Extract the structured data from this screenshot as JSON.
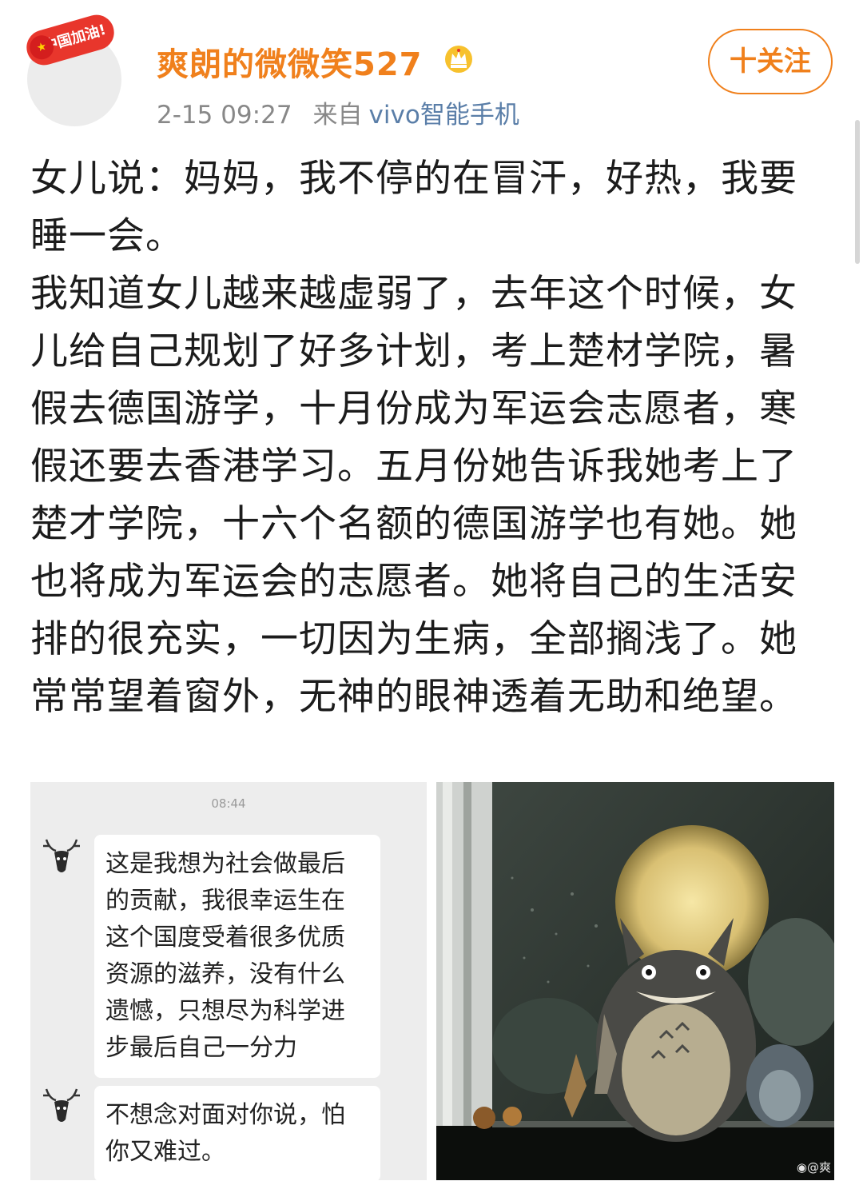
{
  "header": {
    "badge_text": "中国加油!",
    "username": "爽朗的微微笑527",
    "timestamp": "2-15 09:27",
    "from_label": "来自",
    "device": "vivo智能手机",
    "follow_label": "十关注"
  },
  "post": {
    "paragraphs": [
      "女儿说：妈妈，我不停的在冒汗，好热，我要睡一会。",
      "我知道女儿越来越虚弱了，去年这个时候，女儿给自己规划了好多计划，考上楚材学院，暑假去德国游学，十月份成为军运会志愿者，寒假还要去香港学习。五月份她告诉我她考上了楚才学院，十六个名额的德国游学也有她。她也将成为军运会的志愿者。她将自己的生活安排的很充实，一切因为生病，全部搁浅了。她常常望着窗外，无神的眼神透着无助和绝望。"
    ]
  },
  "chat_image": {
    "time": "08:44",
    "messages": [
      {
        "lines": [
          "这是我想为社会做最后",
          "的贡献，我很幸运生在",
          "这个国度受着很多优质",
          "资源的滋养，没有什么",
          "遗憾，只想尽为科学进",
          "步最后自己一分力"
        ]
      },
      {
        "lines": [
          "不想念对面对你说，怕",
          "你又难过。"
        ]
      }
    ]
  },
  "photo_image": {
    "watermark": "@爽"
  },
  "colors": {
    "accent": "#f0801c",
    "device_link": "#5a7ea8",
    "meta_gray": "#888888"
  }
}
